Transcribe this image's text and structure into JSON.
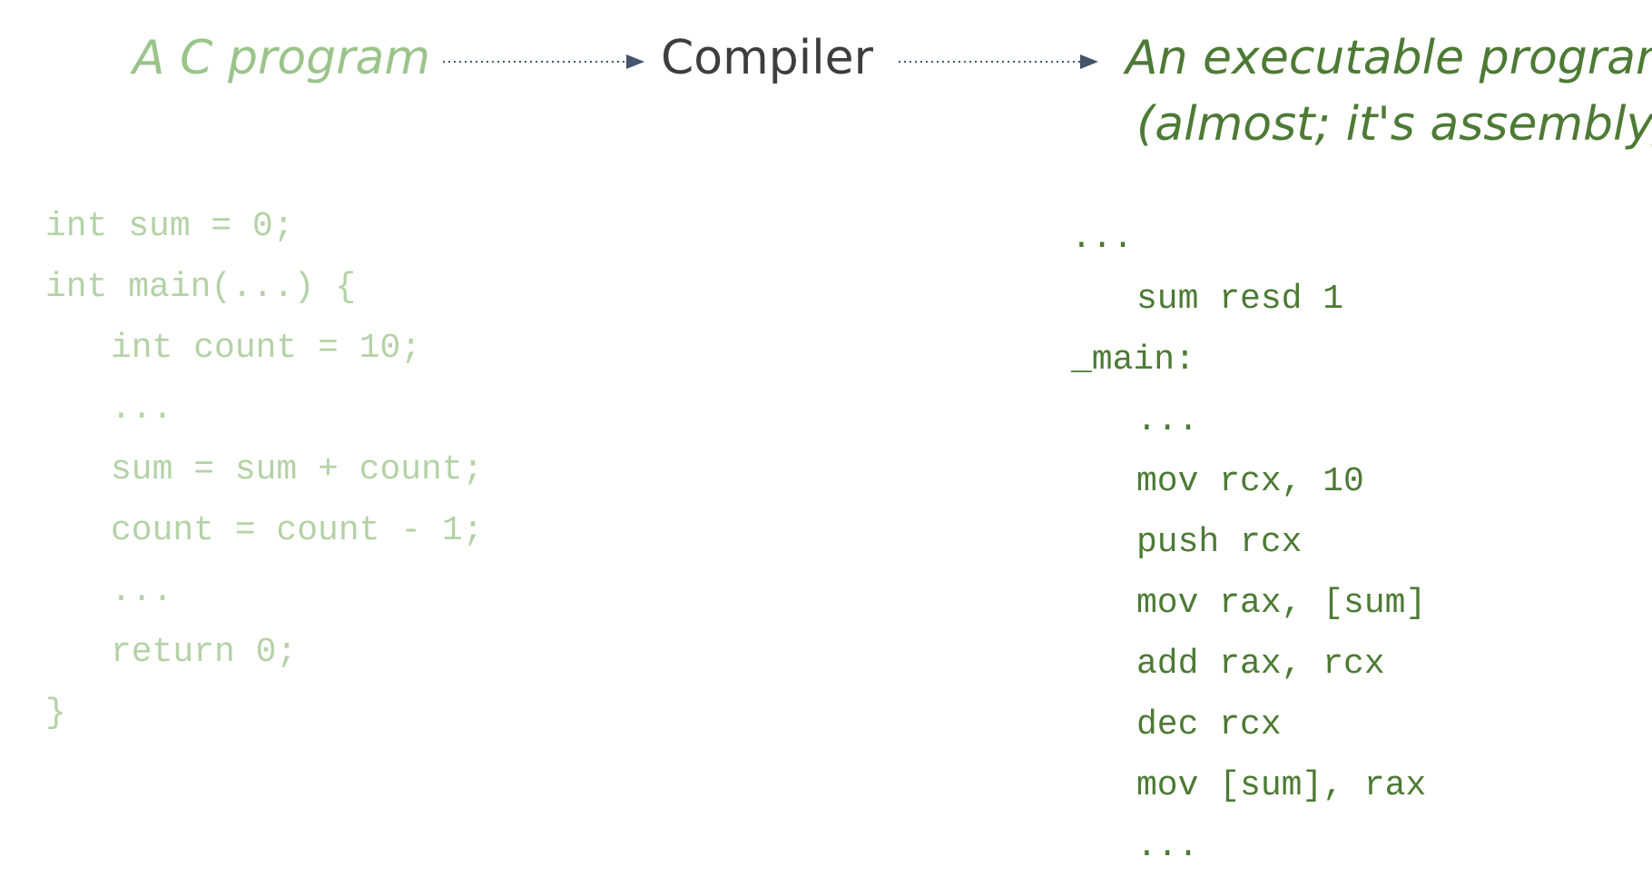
{
  "diagram": {
    "source_label": "A C program",
    "compiler_label": "Compiler",
    "target_label_line1": "An executable program",
    "target_label_line2": "(almost; it's assembly)",
    "colors": {
      "source": "#9bc48a",
      "compiler": "#3d3d3d",
      "target": "#4d7a35",
      "c_code": "#b4d2a6",
      "asm_code": "#4d7a35",
      "arrow": "#44546a"
    },
    "c_code_lines": [
      {
        "text": "int sum = 0;",
        "indent": 0
      },
      {
        "text": "int main(...) {",
        "indent": 0
      },
      {
        "text": "int count = 10;",
        "indent": 1
      },
      {
        "text": "...",
        "indent": 1
      },
      {
        "text": "sum = sum + count;",
        "indent": 1
      },
      {
        "text": "count = count - 1;",
        "indent": 1
      },
      {
        "text": "...",
        "indent": 1
      },
      {
        "text": "return 0;",
        "indent": 1
      },
      {
        "text": "}",
        "indent": 0
      }
    ],
    "asm_code_lines": [
      {
        "text": "...",
        "indent": 0
      },
      {
        "text": "sum resd 1",
        "indent": 1
      },
      {
        "text": "_main:",
        "indent": 0
      },
      {
        "text": "...",
        "indent": 1
      },
      {
        "text": "mov rcx, 10",
        "indent": 1
      },
      {
        "text": "push rcx",
        "indent": 1
      },
      {
        "text": "mov rax, [sum]",
        "indent": 1
      },
      {
        "text": "add rax, rcx",
        "indent": 1
      },
      {
        "text": "dec rcx",
        "indent": 1
      },
      {
        "text": "mov [sum], rax",
        "indent": 1
      },
      {
        "text": "...",
        "indent": 1
      }
    ]
  }
}
